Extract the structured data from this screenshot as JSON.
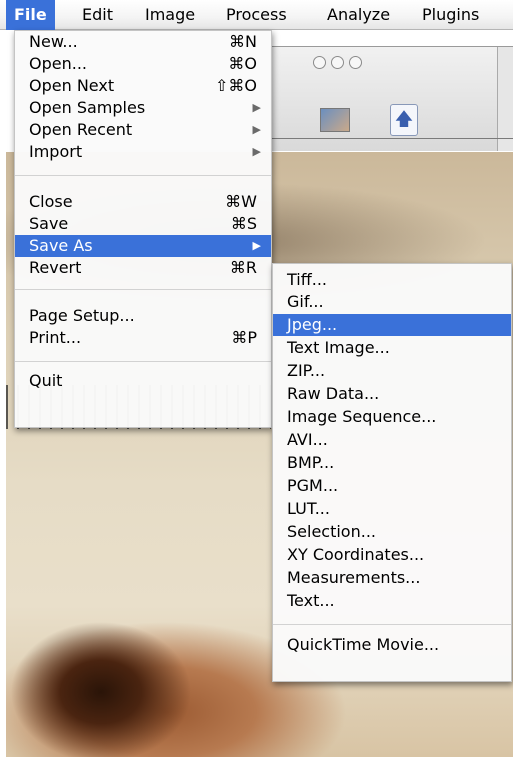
{
  "menubar": {
    "items": [
      "File",
      "Edit",
      "Image",
      "Process",
      "Analyze",
      "Plugins"
    ]
  },
  "file_menu": {
    "items": [
      {
        "label": "New...",
        "shortcut": "⌘N"
      },
      {
        "label": "Open...",
        "shortcut": "⌘O"
      },
      {
        "label": "Open Next",
        "shortcut": "⇧⌘O"
      },
      {
        "label": "Open Samples",
        "submenu": true
      },
      {
        "label": "Open Recent",
        "submenu": true
      },
      {
        "label": "Import",
        "submenu": true
      },
      {
        "label": "Close",
        "shortcut": "⌘W"
      },
      {
        "label": "Save",
        "shortcut": "⌘S"
      },
      {
        "label": "Save As",
        "submenu": true,
        "highlighted": true
      },
      {
        "label": "Revert",
        "shortcut": "⌘R"
      },
      {
        "label": "Page Setup..."
      },
      {
        "label": "Print...",
        "shortcut": "⌘P"
      },
      {
        "label": "Quit"
      }
    ]
  },
  "saveas_menu": {
    "items": [
      {
        "label": "Tiff..."
      },
      {
        "label": "Gif..."
      },
      {
        "label": "Jpeg...",
        "highlighted": true
      },
      {
        "label": "Text Image..."
      },
      {
        "label": "ZIP..."
      },
      {
        "label": "Raw Data..."
      },
      {
        "label": "Image Sequence..."
      },
      {
        "label": "AVI..."
      },
      {
        "label": "BMP..."
      },
      {
        "label": "PGM..."
      },
      {
        "label": "LUT..."
      },
      {
        "label": "Selection..."
      },
      {
        "label": "XY Coordinates..."
      },
      {
        "label": "Measurements..."
      },
      {
        "label": "Text..."
      },
      {
        "label": "QuickTime Movie..."
      }
    ]
  },
  "icons": {
    "submenu_arrow": "▶",
    "toolbar_arrow": "🡅"
  },
  "colors": {
    "highlight": "#3a71d9",
    "menu_bg": "#fafafa"
  }
}
